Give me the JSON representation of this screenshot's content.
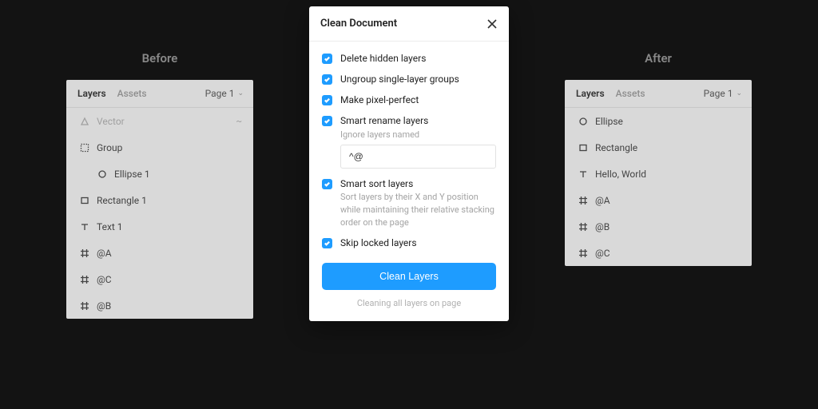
{
  "before": {
    "label": "Before",
    "tabs": {
      "layers": "Layers",
      "assets": "Assets"
    },
    "page": "Page 1",
    "layers": [
      {
        "icon": "triangle",
        "name": "Vector",
        "hidden": true,
        "eye": true
      },
      {
        "icon": "group",
        "name": "Group"
      },
      {
        "icon": "ellipse",
        "name": "Ellipse 1",
        "indent": 1
      },
      {
        "icon": "rect",
        "name": "Rectangle 1"
      },
      {
        "icon": "text",
        "name": "Text 1"
      },
      {
        "icon": "frame",
        "name": "@A"
      },
      {
        "icon": "frame",
        "name": "@C"
      },
      {
        "icon": "frame",
        "name": "@B"
      }
    ]
  },
  "after": {
    "label": "After",
    "tabs": {
      "layers": "Layers",
      "assets": "Assets"
    },
    "page": "Page 1",
    "layers": [
      {
        "icon": "ellipse",
        "name": "Ellipse"
      },
      {
        "icon": "rect",
        "name": "Rectangle"
      },
      {
        "icon": "text",
        "name": "Hello, World"
      },
      {
        "icon": "frame",
        "name": "@A"
      },
      {
        "icon": "frame",
        "name": "@B"
      },
      {
        "icon": "frame",
        "name": "@C"
      }
    ]
  },
  "modal": {
    "title": "Clean Document",
    "options": {
      "delete_hidden": "Delete hidden layers",
      "ungroup_single": "Ungroup single-layer groups",
      "pixel_perfect": "Make pixel-perfect",
      "smart_rename": "Smart rename layers",
      "ignore_label": "Ignore layers named",
      "ignore_value": "^@",
      "smart_sort": "Smart sort layers",
      "sort_desc": "Sort layers by their X and Y position while maintaining their relative stacking order on the page",
      "skip_locked": "Skip locked layers"
    },
    "button": "Clean Layers",
    "status": "Cleaning all layers on page"
  }
}
